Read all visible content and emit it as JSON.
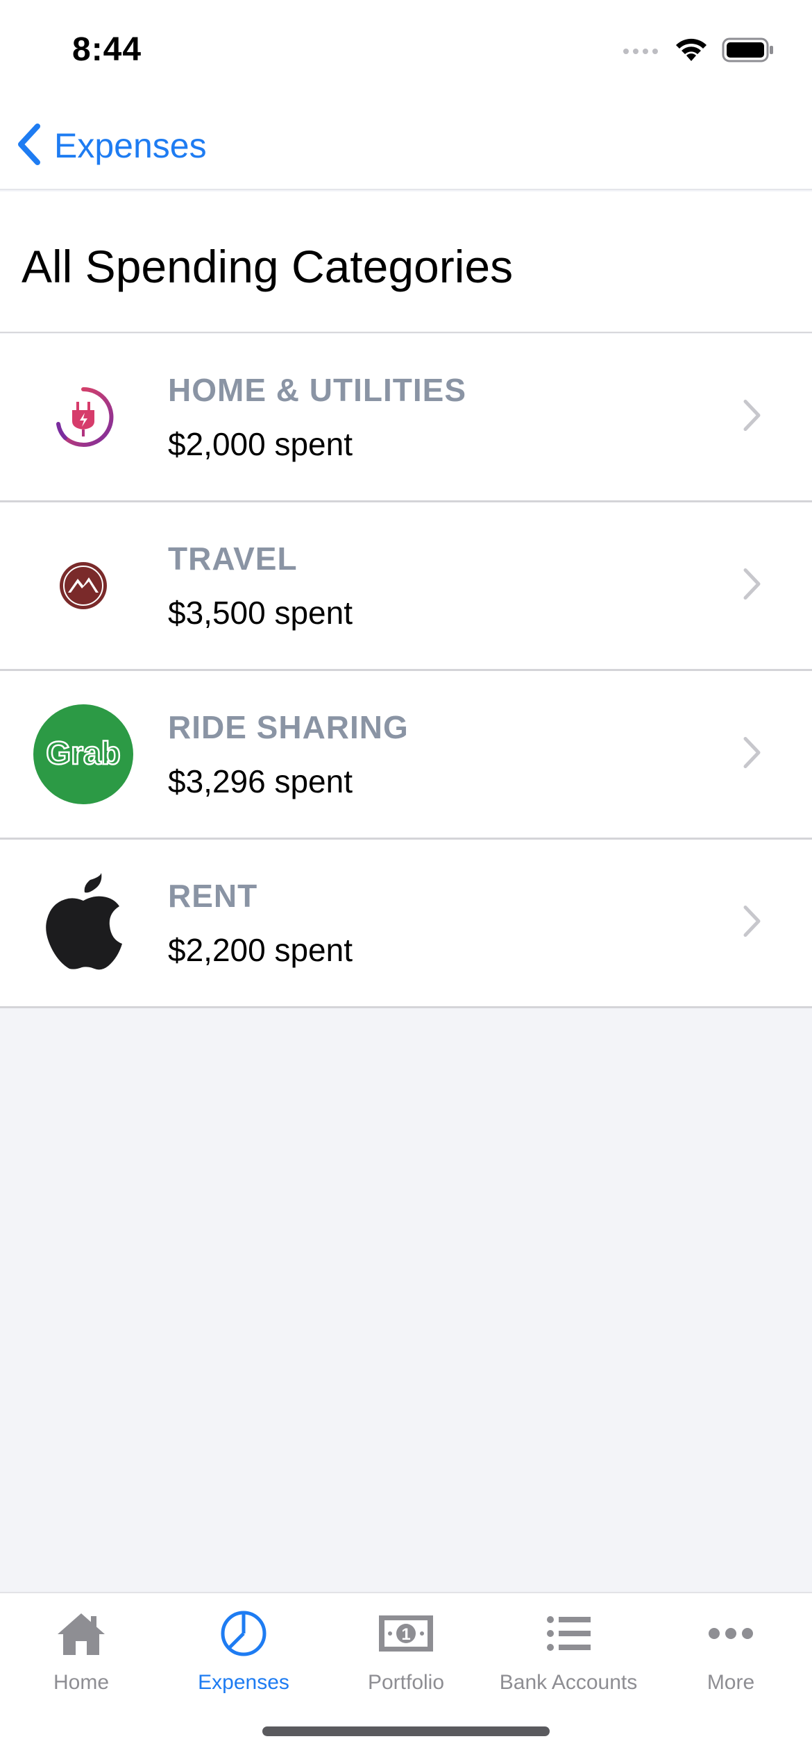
{
  "status_bar": {
    "time": "8:44"
  },
  "nav": {
    "back_label": "Expenses"
  },
  "header": {
    "title": "All Spending Categories"
  },
  "categories": [
    {
      "title": "HOME & UTILITIES",
      "amount": "$2,000 spent",
      "icon": "power-plug-icon"
    },
    {
      "title": "TRAVEL",
      "amount": "$3,500 spent",
      "icon": "mountain-icon"
    },
    {
      "title": "RIDE SHARING",
      "amount": "$3,296 spent",
      "icon": "grab-logo",
      "logo_text": "Grab"
    },
    {
      "title": "RENT",
      "amount": "$2,200 spent",
      "icon": "apple-logo"
    }
  ],
  "tabs": [
    {
      "label": "Home",
      "icon": "home-icon"
    },
    {
      "label": "Expenses",
      "icon": "pie-chart-icon",
      "active": true
    },
    {
      "label": "Portfolio",
      "icon": "banknote-icon"
    },
    {
      "label": "Bank Accounts",
      "icon": "list-icon"
    },
    {
      "label": "More",
      "icon": "more-icon"
    }
  ],
  "colors": {
    "accent": "#1E7CF2",
    "category_title": "#8A94A4",
    "background": "#F3F4F8",
    "grab_green": "#2C9A45",
    "travel_red": "#7A2A2A"
  }
}
